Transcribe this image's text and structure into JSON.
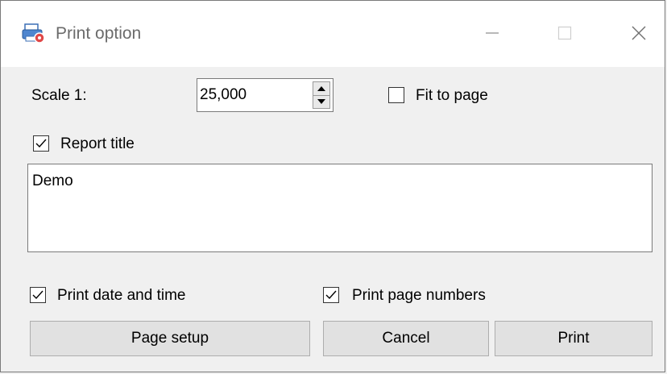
{
  "window": {
    "title": "Print option",
    "controls": {
      "minimize": "minimize-icon",
      "maximize": "maximize-icon",
      "close": "close-icon"
    }
  },
  "scale": {
    "label": "Scale 1:",
    "value": "25,000"
  },
  "fit_to_page": {
    "label": "Fit to page",
    "checked": false
  },
  "report_title": {
    "label": "Report title",
    "checked": true,
    "text": "Demo"
  },
  "print_date_time": {
    "label": "Print date and time",
    "checked": true
  },
  "print_page_numbers": {
    "label": "Print page numbers",
    "checked": true
  },
  "buttons": {
    "page_setup": "Page setup",
    "cancel": "Cancel",
    "print": "Print"
  },
  "colors": {
    "window_bg": "#f0f0f0",
    "titlebar_bg": "#ffffff",
    "button_bg": "#e1e1e1",
    "button_border": "#adadad",
    "title_text": "#6b6b6b"
  }
}
